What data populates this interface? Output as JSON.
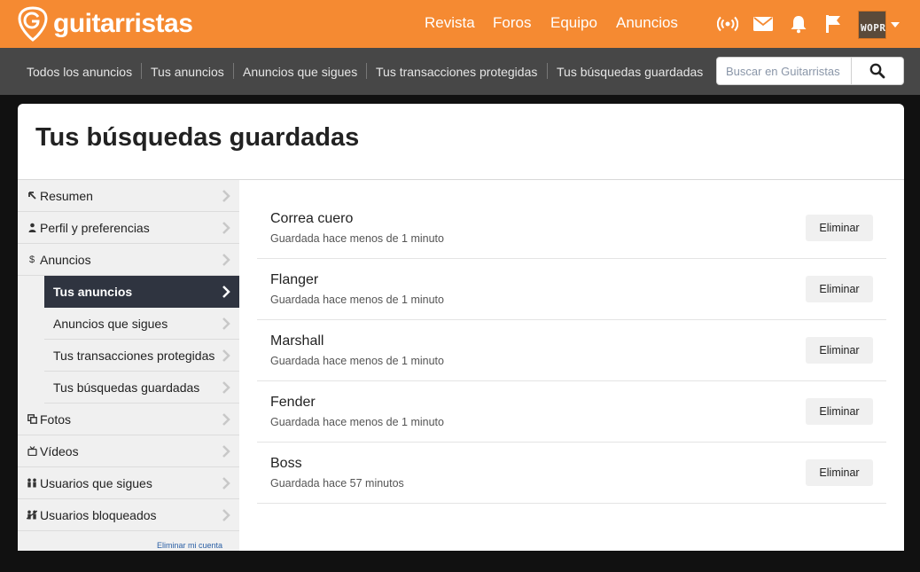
{
  "header": {
    "brand": "guitarristas",
    "nav": [
      "Revista",
      "Foros",
      "Equipo",
      "Anuncios"
    ],
    "icons": [
      "broadcast-icon",
      "mail-icon",
      "bell-icon",
      "flag-icon"
    ],
    "avatar_text": "WOPR",
    "accent_color": "#f58a32"
  },
  "subnav": {
    "items": [
      "Todos los anuncios",
      "Tus anuncios",
      "Anuncios que sigues",
      "Tus transacciones protegidas",
      "Tus búsquedas guardadas"
    ],
    "search_placeholder": "Buscar en Guitarristas",
    "search_icon": "search-icon"
  },
  "page": {
    "title": "Tus búsquedas guardadas"
  },
  "sidebar": {
    "items": [
      {
        "label": "Resumen",
        "icon": "arrow-up-left-icon"
      },
      {
        "label": "Perfil y preferencias",
        "icon": "person-icon"
      },
      {
        "label": "Anuncios",
        "icon": "dollar-icon"
      }
    ],
    "subitems": [
      {
        "label": "Tus anuncios",
        "active": true
      },
      {
        "label": "Anuncios que sigues",
        "active": false
      },
      {
        "label": "Tus transacciones protegidas",
        "active": false
      },
      {
        "label": "Tus búsquedas guardadas",
        "active": false
      }
    ],
    "items_after": [
      {
        "label": "Fotos",
        "icon": "photos-icon"
      },
      {
        "label": "Vídeos",
        "icon": "video-icon"
      },
      {
        "label": "Usuarios que sigues",
        "icon": "users-icon"
      },
      {
        "label": "Usuarios bloqueados",
        "icon": "blocked-users-icon"
      }
    ],
    "delete_account": "Eliminar mi cuenta"
  },
  "saved_searches": [
    {
      "title": "Correa cuero",
      "saved": "Guardada hace menos de 1 minuto",
      "action": "Eliminar"
    },
    {
      "title": "Flanger",
      "saved": "Guardada hace menos de 1 minuto",
      "action": "Eliminar"
    },
    {
      "title": "Marshall",
      "saved": "Guardada hace menos de 1 minuto",
      "action": "Eliminar"
    },
    {
      "title": "Fender",
      "saved": "Guardada hace menos de 1 minuto",
      "action": "Eliminar"
    },
    {
      "title": "Boss",
      "saved": "Guardada hace 57 minutos",
      "action": "Eliminar"
    }
  ]
}
